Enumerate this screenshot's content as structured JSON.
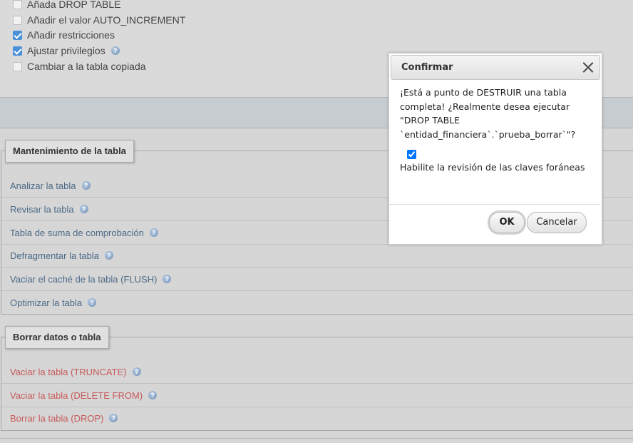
{
  "options": [
    {
      "label": "Añada DROP TABLE",
      "checked": false,
      "help": false
    },
    {
      "label": "Añadir el valor AUTO_INCREMENT",
      "checked": false,
      "help": false
    },
    {
      "label": "Añadir restricciones",
      "checked": true,
      "help": false
    },
    {
      "label": "Ajustar privilegios",
      "checked": true,
      "help": true
    },
    {
      "label": "Cambiar a la tabla copiada",
      "checked": false,
      "help": false
    }
  ],
  "maintenance": {
    "legend": "Mantenimiento de la tabla",
    "items": [
      {
        "label": "Analizar la tabla"
      },
      {
        "label": "Revisar la tabla"
      },
      {
        "label": "Tabla de suma de comprobación"
      },
      {
        "label": "Defragmentar la tabla"
      },
      {
        "label": "Vaciar el caché de la tabla (FLUSH)"
      },
      {
        "label": "Optimizar la tabla"
      }
    ]
  },
  "delete_section": {
    "legend": "Borrar datos o tabla",
    "items": [
      {
        "label": "Vaciar la tabla (TRUNCATE)"
      },
      {
        "label": "Vaciar la tabla (DELETE FROM)"
      },
      {
        "label": "Borrar la tabla (DROP)"
      }
    ]
  },
  "dialog": {
    "title": "Confirmar",
    "message": "¡Está a punto de DESTRUIR una tabla completa! ¿Realmente desea ejecutar \"DROP TABLE `entidad_financiera`.`prueba_borrar`\"?",
    "fk_check_label": "Habilite la revisión de las claves foráneas",
    "fk_check_checked": true,
    "ok_label": "OK",
    "cancel_label": "Cancelar"
  },
  "icons": {
    "help": "help-icon",
    "close": "close-icon"
  },
  "colors": {
    "maintenance_link": "#4c6a87",
    "danger_link": "#c75a5a",
    "checkbox_checked": "#4a90d9"
  }
}
